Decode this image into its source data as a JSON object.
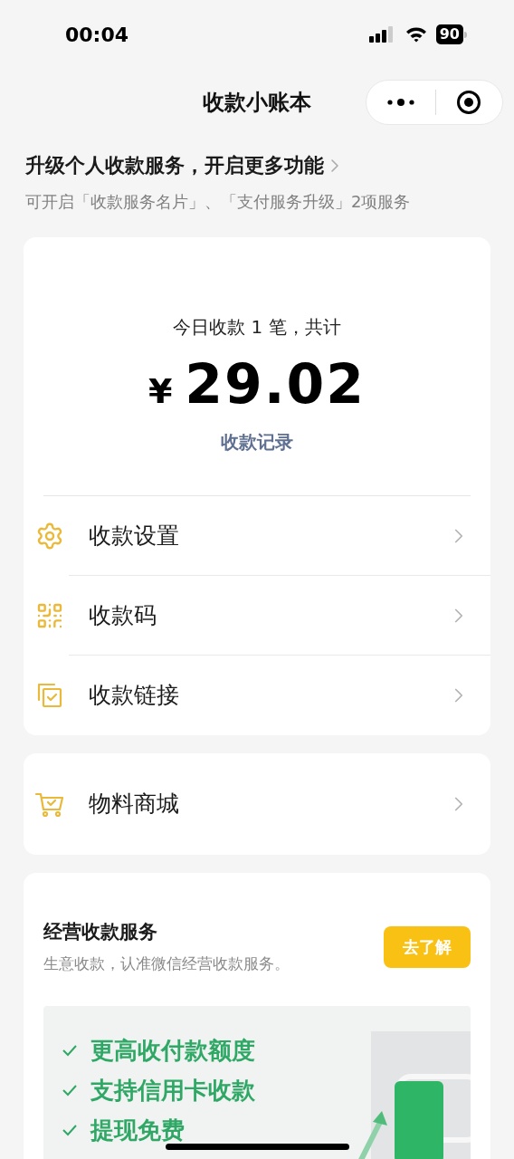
{
  "status_bar": {
    "time": "00:04",
    "battery": "90"
  },
  "nav": {
    "title": "收款小账本"
  },
  "upgrade": {
    "title": "升级个人收款服务，开启更多功能",
    "subtitle": "可开启「收款服务名片」、「支付服务升级」2项服务"
  },
  "summary": {
    "caption": "今日收款 1 笔，共计",
    "currency": "¥",
    "amount": "29.02",
    "link": "收款记录"
  },
  "menu": [
    {
      "kind": "settings",
      "label": "收款设置"
    },
    {
      "kind": "qr",
      "label": "收款码"
    },
    {
      "kind": "link",
      "label": "收款链接"
    }
  ],
  "shop": [
    {
      "kind": "cart",
      "label": "物料商城"
    }
  ],
  "service": {
    "title": "经营收款服务",
    "subtitle": "生意收款，认准微信经营收款服务。",
    "button": "去了解",
    "features": [
      "更高收付款额度",
      "支持信用卡收款",
      "提现免费"
    ]
  }
}
